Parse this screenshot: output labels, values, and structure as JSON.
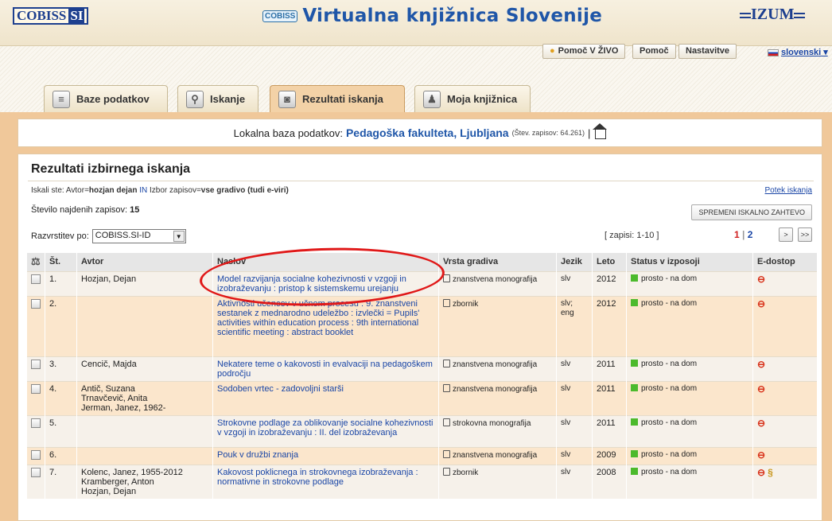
{
  "header": {
    "cobiss_logo": "COBISS",
    "cobiss_logo_si": "SI",
    "cobiss_mini": "COBISS",
    "title": "Virtualna knjižnica Slovenije",
    "izum": "IZUM"
  },
  "topbuttons": {
    "pomoc_zivo": "Pomoč V ŽIVO",
    "pomoc": "Pomoč",
    "nastavitve": "Nastavitve",
    "language": "slovenski"
  },
  "tabs": [
    {
      "label": "Baze podatkov"
    },
    {
      "label": "Iskanje"
    },
    {
      "label": "Rezultati iskanja"
    },
    {
      "label": "Moja knjižnica"
    }
  ],
  "lokal": {
    "prefix": "Lokalna baza podatkov:",
    "name": "Pedagoška fakulteta, Ljubljana",
    "count": "(Štev. zapisov: 64.261)",
    "sep": "|"
  },
  "results": {
    "heading": "Rezultati izbirnega iskanja",
    "query_prefix": "Iskali ste: Avtor=",
    "query_author": "hozjan dejan",
    "query_in": "IN",
    "query_mid": "Izbor zapisov=",
    "query_material": "vse gradivo (tudi e-viri)",
    "potek": "Potek iskanja",
    "stevilo_label": "Število najdenih zapisov:",
    "stevilo_value": "15",
    "spremeni": "SPREMENI ISKALNO ZAHTEVO",
    "razvrstitev_label": "Razvrstitev po:",
    "razvrstitev_value": "COBISS.SI-ID",
    "zapisi": "[ zapisi: 1-10 ]",
    "page_current": "1",
    "page_sep": "|",
    "page_next": "2",
    "next_btn": ">",
    "last_btn": ">>"
  },
  "table": {
    "headers": [
      "Št.",
      "Avtor",
      "Naslov",
      "Vrsta gradiva",
      "Jezik",
      "Leto",
      "Status v izposoji",
      "E-dostop"
    ],
    "rows": [
      {
        "num": "1.",
        "author": "Hozjan, Dejan",
        "title": "Model razvijanja socialne kohezivnosti v vzgoji in izobraževanju : pristop k sistemskemu urejanju",
        "type": "znanstvena monografija",
        "lang": "slv",
        "year": "2012",
        "status": "prosto - na dom",
        "edost": "⊖"
      },
      {
        "num": "2.",
        "author": "",
        "title": "Aktivnosti učencev v učnem procesu : 9. znanstveni sestanek z mednarodno udeležbo : izvlečki = Pupils' activities within education process : 9th international scientific meeting : abstract booklet",
        "type": "zbornik",
        "lang": "slv; eng",
        "year": "2012",
        "status": "prosto - na dom",
        "edost": "⊖"
      },
      {
        "num": "3.",
        "author": "Cencič, Majda",
        "title": "Nekatere teme o kakovosti in evalvaciji na pedagoškem področju",
        "type": "znanstvena monografija",
        "lang": "slv",
        "year": "2011",
        "status": "prosto - na dom",
        "edost": "⊖"
      },
      {
        "num": "4.",
        "author": "Antič, Suzana\nTrnavčevič, Anita\nJerman, Janez, 1962-",
        "title": "Sodoben vrtec - zadovoljni starši",
        "type": "znanstvena monografija",
        "lang": "slv",
        "year": "2011",
        "status": "prosto - na dom",
        "edost": "⊖"
      },
      {
        "num": "5.",
        "author": "",
        "title": "Strokovne podlage za oblikovanje socialne kohezivnosti v vzgoji in izobraževanju : II. del izobraževanja",
        "type": "strokovna monografija",
        "lang": "slv",
        "year": "2011",
        "status": "prosto - na dom",
        "edost": "⊖"
      },
      {
        "num": "6.",
        "author": "",
        "title": "Pouk v družbi znanja",
        "type": "znanstvena monografija",
        "lang": "slv",
        "year": "2009",
        "status": "prosto - na dom",
        "edost": "⊖"
      },
      {
        "num": "7.",
        "author": "Kolenc, Janez, 1955-2012\nKramberger, Anton\nHozjan, Dejan",
        "title": "Kakovost poklicnega in strokovnega izobraževanja : normativne in strokovne podlage",
        "type": "zbornik",
        "lang": "slv",
        "year": "2008",
        "status": "prosto - na dom",
        "edost": "⊖",
        "edost2": "§"
      }
    ]
  },
  "colors": {
    "accent_blue": "#1f56a8",
    "tab_active": "#f3d2a7",
    "frame": "#f0c89a",
    "annotation_red": "#e01818"
  }
}
